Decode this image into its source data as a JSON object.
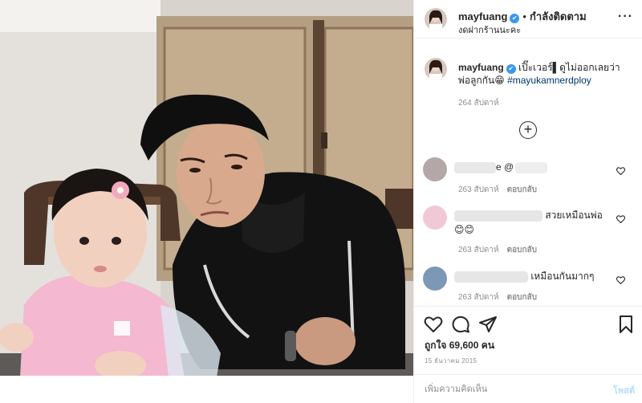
{
  "header": {
    "username": "mayfuang",
    "verified_mark": "✔",
    "separator": "•",
    "follow_status": "กำลังติดตาม",
    "location": "งดฝากร้านนะคะ",
    "more_icon": "more-horizontal-icon"
  },
  "caption": {
    "username": "mayfuang",
    "text": " เปิ๊ะเวอร์▌ดูไม่ออกเลยว่าพ่อลูกกัน😁 ",
    "hashtag": "#mayukamnerdploy",
    "time": "264 สัปดาห์"
  },
  "load_more_icon": "plus-circle-icon",
  "comments": [
    {
      "text_before": "",
      "text_after": "e @",
      "time": "263 สัปดาห์",
      "reply": "ตอบกลับ",
      "avatar_color": "#b4a7a7"
    },
    {
      "text_before": "",
      "text_after": " สวยเหมือนพ่อ",
      "emoji": "😊😊",
      "time": "263 สัปดาห์",
      "reply": "ตอบกลับ",
      "avatar_color": "#f1c9d6"
    },
    {
      "text_before": "",
      "text_after": " เหมือนกันมากๆ",
      "time": "263 สัปดาห์",
      "reply": "ตอบกลับ",
      "avatar_color": "#7d98b5"
    }
  ],
  "actions": {
    "like_icon": "heart-icon",
    "comment_icon": "comment-icon",
    "share_icon": "paper-plane-icon",
    "save_icon": "bookmark-icon"
  },
  "likes": "ถูกใจ 69,600 คน",
  "date": "15 ธันวาคม 2015",
  "compose": {
    "placeholder": "เพิ่มความคิดเห็น",
    "post_label": "โพสต์"
  },
  "colors": {
    "link": "#00376b",
    "verified": "#3897f0",
    "muted": "#8e8e8e",
    "post_disabled": "#b2dffc"
  }
}
